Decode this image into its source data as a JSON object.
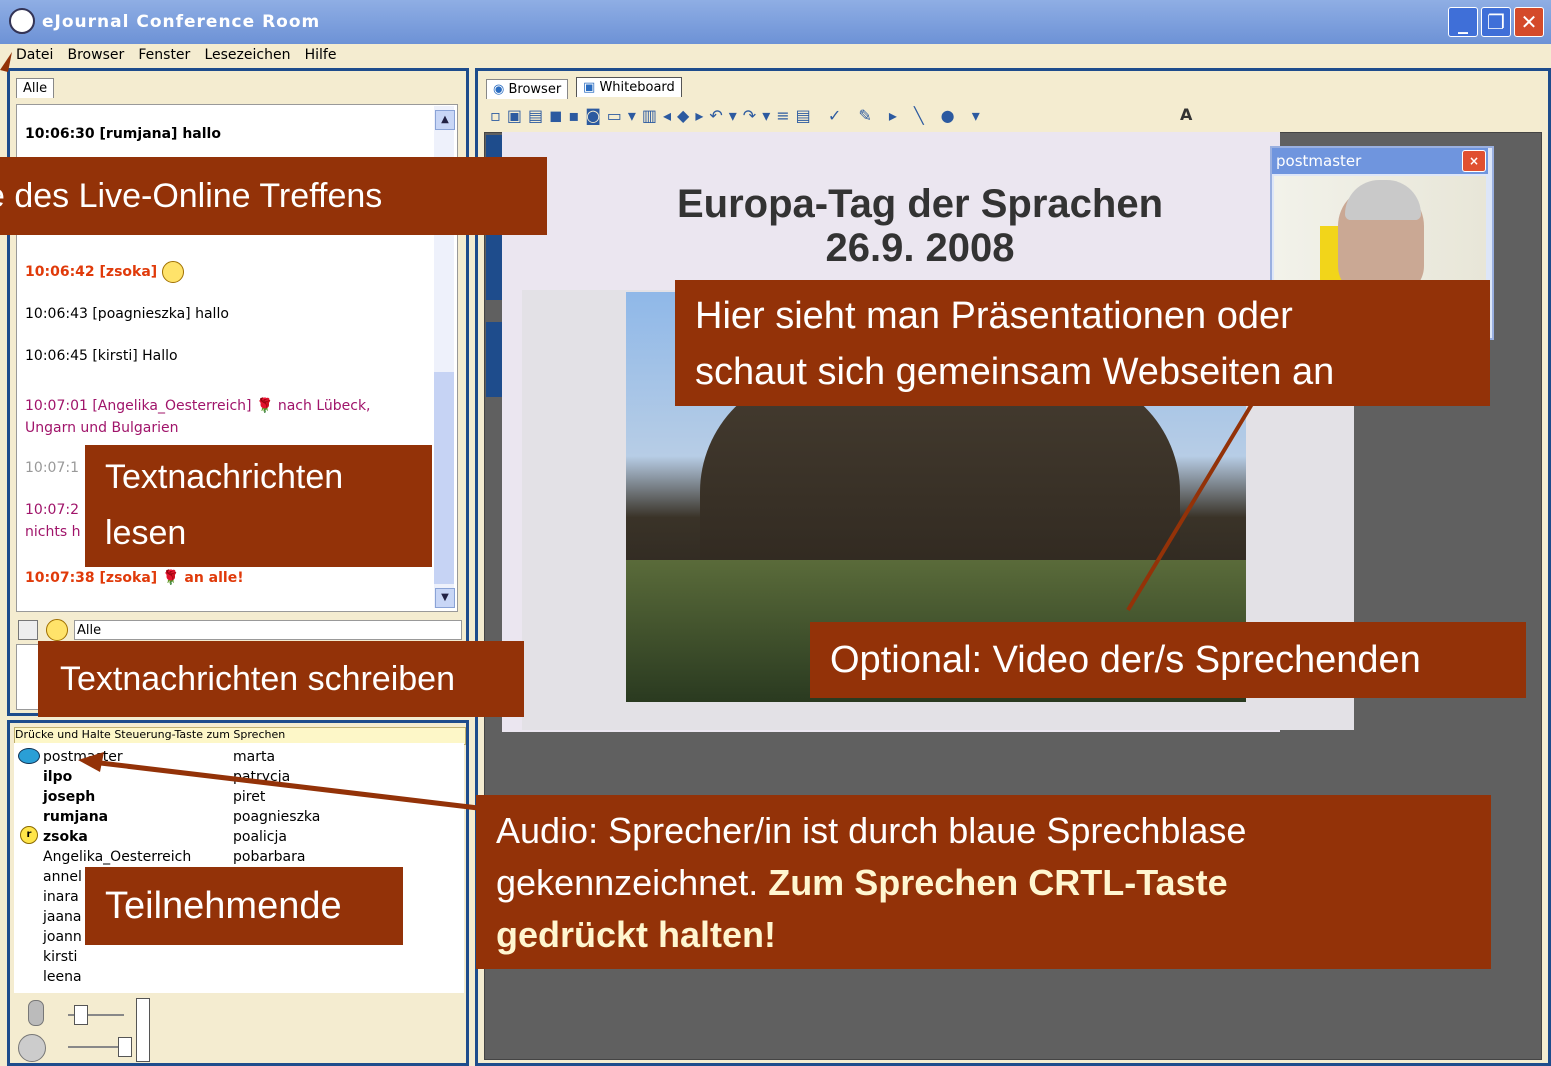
{
  "window": {
    "title": "eJournal Conference Room",
    "min": "_",
    "max": "❐",
    "close": "✕"
  },
  "menu": [
    "Datei",
    "Browser",
    "Fenster",
    "Lesezeichen",
    "Hilfe"
  ],
  "chat": {
    "tab": "Alle",
    "messages": [
      {
        "time": "10:06:30",
        "user": "[rumjana]",
        "text": "hallo"
      },
      {
        "time": "10:06:42",
        "user": "[zsoka]",
        "text": ""
      },
      {
        "time": "10:06:43",
        "user": "[poagnieszka]",
        "text": "hallo"
      },
      {
        "time": "10:06:45",
        "user": "[kirsti]",
        "text": "Hallo"
      },
      {
        "time": "10:07:01",
        "user": "[Angelika_Oesterreich]",
        "text": "nach Lübeck,",
        "text2": "Ungarn und Bulgarien"
      },
      {
        "time": "10:07:1",
        "user": "",
        "text": ""
      },
      {
        "time": "10:07:2",
        "user": "",
        "text": "",
        "text2": "nichts h"
      },
      {
        "time": "10:07:38",
        "user": "[zsoka]",
        "text": "an alle!"
      }
    ],
    "recipient": "Alle"
  },
  "voice": {
    "hint": "Drücke und Halte Steuerung-Taste zum Sprechen",
    "users_col1": [
      "postmaster",
      "ilpo",
      "joseph",
      "rumjana",
      "zsoka",
      "Angelika_Oesterreich",
      "annel",
      "inara",
      "jaana",
      "joann",
      "kirsti",
      "leena"
    ],
    "users_col2": [
      "marta",
      "patrycja",
      "piret",
      "poagnieszka",
      "poalicja",
      "pobarbara"
    ]
  },
  "whiteboard": {
    "tabs": [
      "Browser",
      "Whiteboard"
    ],
    "slide_title": "Europa-Tag der Sprachen",
    "slide_date": "26.9. 2008",
    "toolbar_text": "A"
  },
  "video": {
    "title": "postmaster",
    "close": "×"
  },
  "callouts": {
    "meeting": "e des Live-Online Treffens",
    "read_line1": "Textnachrichten",
    "read_line2": "lesen",
    "write": "Textnachrichten schreiben",
    "people": "Teilnehmende",
    "present_line1": "Hier sieht man Präsentationen oder",
    "present_line2": "schaut sich gemeinsam Webseiten an",
    "video": "Optional: Video der/s Sprechenden",
    "audio_line1": "Audio: Sprecher/in ist durch blaue Sprechblase",
    "audio_line2a": "gekennzeichnet. ",
    "audio_line2b": "Zum Sprechen CRTL-Taste",
    "audio_line3": "gedrückt halten!"
  },
  "colors": {
    "callout_bg": "#933208",
    "frame": "#1e4c8c",
    "panel_bg": "#f4ecd0"
  }
}
